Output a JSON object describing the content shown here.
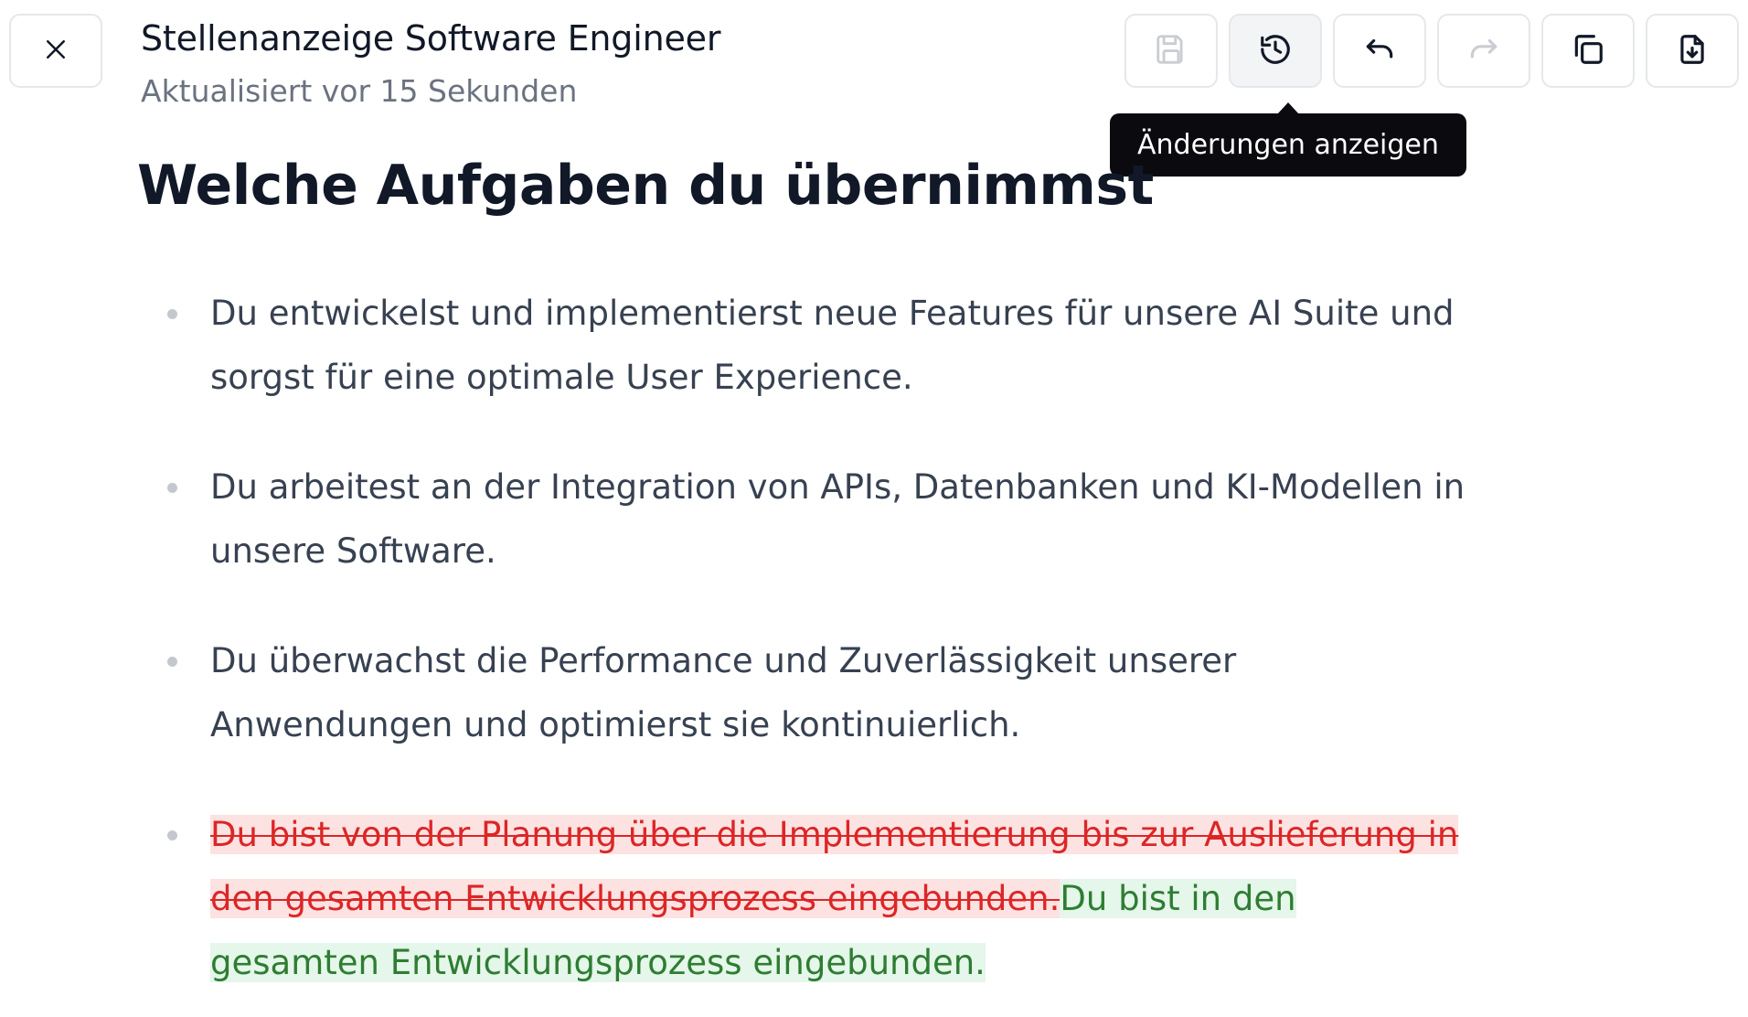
{
  "header": {
    "title": "Stellenanzeige Software Engineer",
    "subtitle": "Aktualisiert vor 15 Sekunden"
  },
  "toolbar": {
    "buttons": [
      {
        "icon": "save-icon",
        "label": "Speichern",
        "state": "disabled"
      },
      {
        "icon": "history-icon",
        "label": "Änderungen anzeigen",
        "state": "active"
      },
      {
        "icon": "undo-icon",
        "label": "Rückgängig",
        "state": "enabled"
      },
      {
        "icon": "redo-icon",
        "label": "Wiederholen",
        "state": "disabled"
      },
      {
        "icon": "copy-icon",
        "label": "Kopieren",
        "state": "enabled"
      },
      {
        "icon": "download-icon",
        "label": "Herunterladen",
        "state": "enabled"
      }
    ],
    "tooltip": "Änderungen anzeigen"
  },
  "content": {
    "heading": "Welche Aufgaben du übernimmst",
    "items": [
      {
        "text": "Du entwickelst und implementierst neue Features für unsere AI Suite und sorgst für eine optimale User Experience."
      },
      {
        "text": "Du arbeitest an der Integration von APIs, Datenbanken und KI-Modellen in unsere Software."
      },
      {
        "text": "Du überwachst die Performance und Zuverlässigkeit unserer Anwendungen und optimierst sie kontinuierlich."
      },
      {
        "deleted": "Du bist von der Planung über die Implementierung bis zur Auslieferung in den gesamten Entwicklungsprozess eingebunden.",
        "inserted": "Du bist in den gesamten Entwicklungsprozess eingebunden."
      }
    ]
  },
  "colors": {
    "deleted_text": "#dc2626",
    "deleted_bg": "#fde2e2",
    "inserted_text": "#2e7d32",
    "inserted_bg": "#e5f6ea",
    "tooltip_bg": "#0b0b0f"
  }
}
